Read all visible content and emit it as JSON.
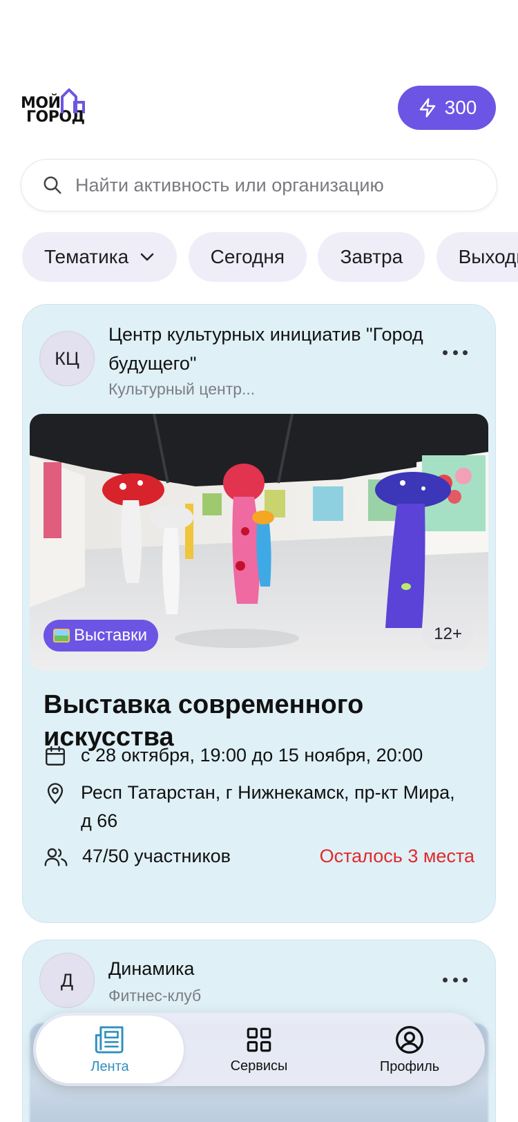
{
  "header": {
    "logo_line1": "МОЙ",
    "logo_line2": "ГОРОД",
    "points": "300",
    "accent_color": "#6c55e4"
  },
  "search": {
    "placeholder": "Найти активность или организацию"
  },
  "filters": [
    {
      "label": "Тематика",
      "icon": "chevron-down-icon"
    },
    {
      "label": "Сегодня"
    },
    {
      "label": "Завтра"
    },
    {
      "label": "Выходные"
    }
  ],
  "cards": [
    {
      "org_initials": "КЦ",
      "org_name": "Центр культурных инициатив \"Город будущего\"",
      "org_type": "Культурный центр...",
      "category": "Выставки",
      "category_icon": "framed-picture-icon",
      "age": "12+",
      "title": "Выставка современного искусства",
      "date": "с 28 октября, 19:00 до 15 ноября, 20:00",
      "address": "Респ Татарстан, г Нижнекамск, пр-кт Мира, д 66",
      "participants": "47/50 участников",
      "remaining": "Осталось 3 места"
    },
    {
      "org_initials": "Д",
      "org_name": "Динамика",
      "org_type": "Фитнес-клуб"
    }
  ],
  "nav": {
    "items": [
      {
        "label": "Лента",
        "icon": "news-icon",
        "active": true
      },
      {
        "label": "Сервисы",
        "icon": "grid-icon",
        "active": false
      },
      {
        "label": "Профиль",
        "icon": "user-circle-icon",
        "active": false
      }
    ]
  }
}
